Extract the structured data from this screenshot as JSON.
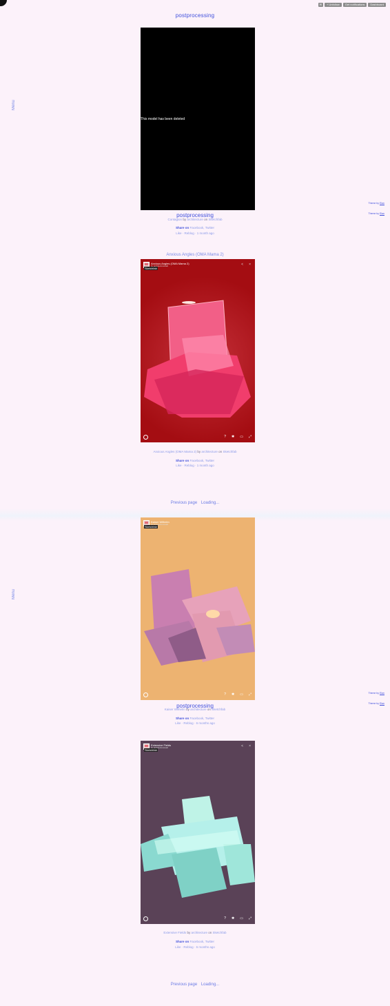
{
  "site": {
    "title": "postprocessing"
  },
  "topbar": {
    "buttons": [
      {
        "label": ""
      },
      {
        "label": "+ Unfollow"
      },
      {
        "label": "Get notifications"
      },
      {
        "label": "Dashboard"
      }
    ]
  },
  "menu_label": "Menu",
  "theme": {
    "prefix": "Theme by ",
    "link": "Elan"
  },
  "pager": {
    "previous": "Previous page",
    "loading": "Loading..."
  },
  "posts": [
    {
      "title": "",
      "viewer_message": "This model has been deleted",
      "caption_model": "Contagion",
      "caption_by": "by",
      "caption_author": "architecture",
      "caption_on": "on",
      "caption_site": "Sketchfab",
      "share_label": "Share on",
      "share_links": "Facebook, Twitter",
      "meta": "Like · Reblog · 1 month ago",
      "bg": "#000000"
    },
    {
      "title": "Anxious Angles (OMA Mama 2)",
      "viewer_title": "Anxious Angles (OMA Mama 2)",
      "viewer_sub": "by architectureweb",
      "caption_model": "Anxious Angles (OMA Mama 2)",
      "caption_by": "by",
      "caption_author": "architecture",
      "caption_on": "on",
      "caption_site": "Sketchfab",
      "share_label": "Share on",
      "share_links": "Facebook, Twitter",
      "meta": "Like · Reblog · 1 month ago",
      "bg": "#a40d12"
    },
    {
      "title": "",
      "viewer_title": "Kaiser Wilhelm",
      "viewer_sub": "by architectureweb",
      "caption_model": "Kaiser Wilhelm",
      "caption_by": "by",
      "caption_author": "architecture",
      "caption_on": "on",
      "caption_site": "Sketchfab",
      "share_label": "Share on",
      "share_links": "Facebook, Twitter",
      "meta": "Like · Reblog · 6 months ago",
      "bg": "#edb371"
    },
    {
      "title": "",
      "viewer_title": "Extensive Fields",
      "viewer_sub": "by architectureweb",
      "caption_model": "Extensive Fields",
      "caption_by": "by",
      "caption_author": "architecture",
      "caption_on": "on",
      "caption_site": "Sketchfab",
      "share_label": "Share on",
      "share_links": "Facebook, Twitter",
      "meta": "Like · Reblog · 6 months ago",
      "bg": "#5a4257"
    }
  ],
  "sketchfab_label": "Sketchfab",
  "viewer_controls": {
    "help": "?",
    "settings": "✱",
    "vr": "▭",
    "fullscreen": "⤢"
  },
  "viewer_tools": {
    "share": "<",
    "close": "×"
  }
}
